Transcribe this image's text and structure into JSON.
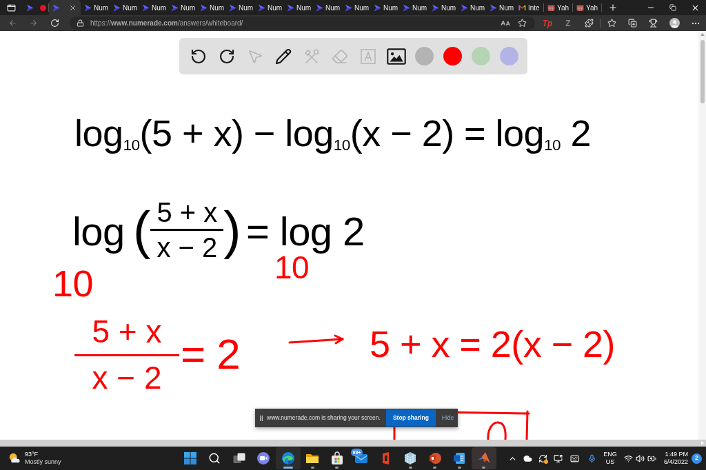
{
  "browser": {
    "tabs": [
      {
        "kind": "numerade",
        "recording": true,
        "selected": false
      },
      {
        "kind": "numerade",
        "recording": false,
        "selected": true
      },
      {
        "kind": "numerade",
        "label": "Num",
        "recording": false,
        "selected": false
      },
      {
        "kind": "numerade",
        "label": "Num",
        "recording": false,
        "selected": false
      },
      {
        "kind": "numerade",
        "label": "Num",
        "recording": false,
        "selected": false
      },
      {
        "kind": "numerade",
        "label": "Num",
        "recording": false,
        "selected": false
      },
      {
        "kind": "numerade",
        "label": "Num",
        "recording": false,
        "selected": false
      },
      {
        "kind": "numerade",
        "label": "Num",
        "recording": false,
        "selected": false
      },
      {
        "kind": "numerade",
        "label": "Num",
        "recording": false,
        "selected": false
      },
      {
        "kind": "numerade",
        "label": "Num",
        "recording": false,
        "selected": false
      },
      {
        "kind": "numerade",
        "label": "Num",
        "recording": false,
        "selected": false
      },
      {
        "kind": "numerade",
        "label": "Num",
        "recording": false,
        "selected": false
      },
      {
        "kind": "numerade",
        "label": "Num",
        "recording": false,
        "selected": false
      },
      {
        "kind": "numerade",
        "label": "Num",
        "recording": false,
        "selected": false
      },
      {
        "kind": "numerade",
        "label": "Num",
        "recording": false,
        "selected": false
      },
      {
        "kind": "numerade",
        "label": "Num",
        "recording": false,
        "selected": false
      },
      {
        "kind": "numerade",
        "label": "Num",
        "recording": false,
        "selected": false
      },
      {
        "kind": "gmail",
        "label": "Inte",
        "recording": false,
        "selected": false
      },
      {
        "kind": "yahoo",
        "label": "Yah",
        "recording": false,
        "selected": false
      },
      {
        "kind": "yahoo",
        "label": "Yah",
        "recording": false,
        "selected": false
      }
    ],
    "navigation": {
      "back_disabled": true,
      "forward_disabled": true
    },
    "address_bar": {
      "url": "https://**www.numerade.com**/answers/whiteboard/"
    },
    "extensions": [
      {
        "kind": "tp",
        "label": "Tp"
      },
      {
        "kind": "z",
        "label": "Z"
      }
    ]
  },
  "whiteboard": {
    "tools": [
      {
        "kind": "undo",
        "disabled": false
      },
      {
        "kind": "redo",
        "disabled": false
      },
      {
        "kind": "pointer",
        "disabled": true
      },
      {
        "kind": "pencil",
        "disabled": false
      },
      {
        "kind": "tools",
        "disabled": true
      },
      {
        "kind": "eraser",
        "disabled": true
      },
      {
        "kind": "text",
        "disabled": true
      },
      {
        "kind": "image",
        "disabled": false
      }
    ],
    "colors": [
      {
        "color": "#b3b3b3"
      },
      {
        "color": "#ff0000"
      },
      {
        "color": "#b4d4b4"
      },
      {
        "color": "#b3b3e8"
      }
    ],
    "items": [
      {
        "kind": "text",
        "color": "#000000",
        "text": "log$_{10}$(5 + x) − log$_{10}$(x − 2) = log$_{10}$ 2"
      },
      {
        "kind": "text",
        "color": "#000000",
        "text": "log"
      },
      {
        "kind": "fraction",
        "color": "#000000",
        "left": "(",
        "right": ")",
        "numerator": "5 + x",
        "denominator": "x − 2"
      },
      {
        "kind": "text",
        "color": "#000000",
        "text": "= log 2"
      },
      {
        "kind": "text",
        "color": "#ff0000",
        "text": "10"
      },
      {
        "kind": "text",
        "color": "#ff0000",
        "text": "10"
      },
      {
        "kind": "fraction",
        "color": "#ff0000",
        "numerator": "5 + x",
        "denominator": "x − 2"
      },
      {
        "kind": "text",
        "color": "#ff0000",
        "text": "= 2"
      },
      {
        "kind": "arrow",
        "color": "#ff0000"
      },
      {
        "kind": "text",
        "color": "#ff0000",
        "text": "5 + x = 2(x − 2)"
      },
      {
        "kind": "box",
        "color": "#ff0000"
      }
    ]
  },
  "share_notice": {
    "message": "www.numerade.com is sharing your screen.",
    "stop_button": "Stop sharing",
    "hide_link": "Hide"
  },
  "taskbar": {
    "weather": {
      "temperature": "93°F",
      "condition": "Mostly sunny"
    },
    "apps": [
      {
        "kind": "start",
        "running": false,
        "focused": false,
        "highlighted": false
      },
      {
        "kind": "search",
        "running": false,
        "focused": false,
        "highlighted": false
      },
      {
        "kind": "task_view",
        "running": false,
        "focused": false,
        "highlighted": false
      },
      {
        "kind": "chat",
        "running": false,
        "focused": false,
        "highlighted": false
      },
      {
        "kind": "browser",
        "running": true,
        "focused": true,
        "highlighted": false
      },
      {
        "kind": "folder",
        "running": true,
        "focused": false,
        "highlighted": false
      },
      {
        "kind": "store",
        "running": true,
        "focused": false,
        "highlighted": false
      },
      {
        "kind": "mail",
        "badge": "99+",
        "running": false,
        "focused": false,
        "highlighted": false
      },
      {
        "kind": "office",
        "running": false,
        "focused": false,
        "highlighted": false
      },
      {
        "kind": "cube",
        "running": true,
        "focused": false,
        "highlighted": false
      },
      {
        "kind": "presentation",
        "running": true,
        "focused": false,
        "highlighted": false
      },
      {
        "kind": "document",
        "running": true,
        "focused": false,
        "highlighted": false
      },
      {
        "kind": "peaks",
        "running": true,
        "focused": false,
        "highlighted": true
      }
    ],
    "tray": {
      "language": "ENG",
      "region": "US",
      "time": "1:49 PM",
      "date": "6/4/2022",
      "notifications": "2"
    }
  }
}
